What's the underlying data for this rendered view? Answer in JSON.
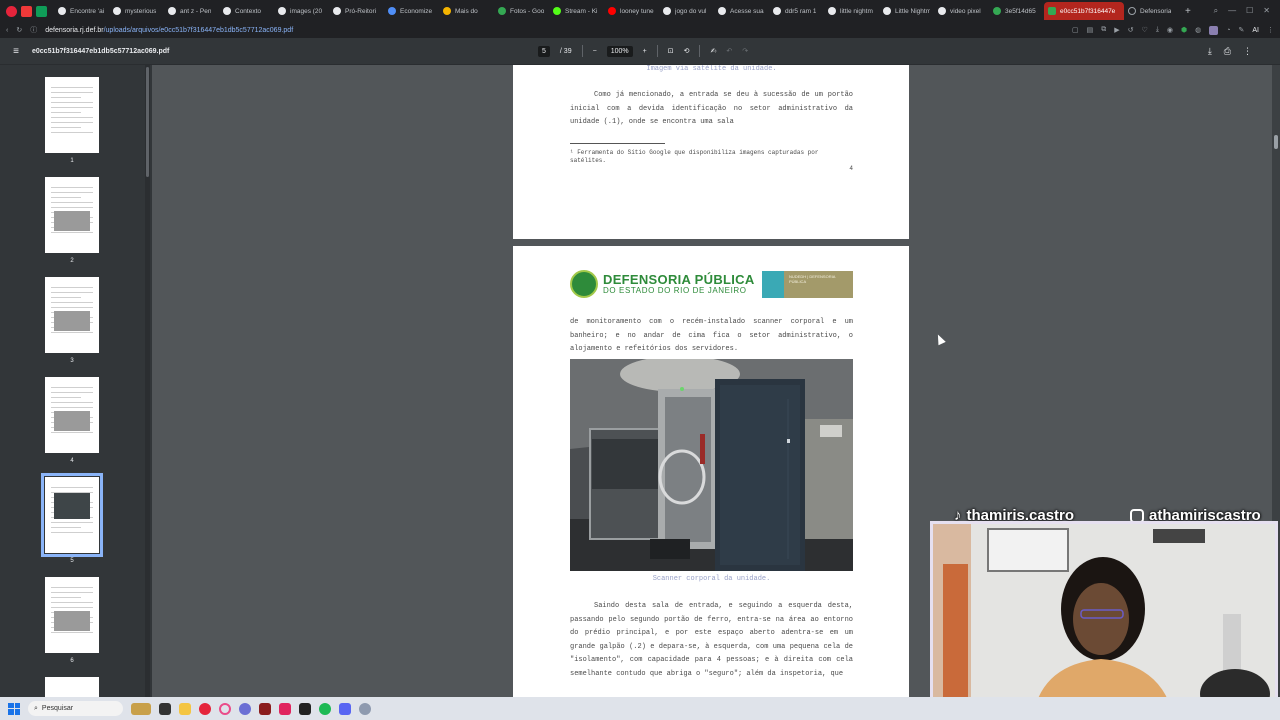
{
  "browser": {
    "tabs": [
      {
        "label": "Encontre 'ai",
        "color": "#e8eaed"
      },
      {
        "label": "mysterious",
        "color": "#e8eaed"
      },
      {
        "label": "ant z - Pen",
        "color": "#e8eaed"
      },
      {
        "label": "Contexto",
        "color": "#e8eaed"
      },
      {
        "label": "images (20",
        "color": "#e8eaed"
      },
      {
        "label": "Pró-Reitori",
        "color": "#e8eaed"
      },
      {
        "label": "Economize",
        "color": "#4f8ef7"
      },
      {
        "label": "Mais do",
        "color": "#f4b400"
      },
      {
        "label": "Fotos - Goo",
        "color": "#34a853"
      },
      {
        "label": "Stream - Ki",
        "color": "#53fc18"
      },
      {
        "label": "looney tune",
        "color": "#ff0000"
      },
      {
        "label": "jogo do vul",
        "color": "#e8eaed"
      },
      {
        "label": "Acesse sua",
        "color": "#e8eaed"
      },
      {
        "label": "ddr5 ram 1",
        "color": "#e8eaed"
      },
      {
        "label": "little nightm",
        "color": "#e8eaed"
      },
      {
        "label": "Little Nightm",
        "color": "#e8eaed"
      },
      {
        "label": "video pixel",
        "color": "#e8eaed"
      },
      {
        "label": "3e5f14d65",
        "color": "#34a853"
      }
    ],
    "active_tab": "e0cc51b7f316447e",
    "last_tab": "Defensoria",
    "url_host": "defensoria.rj.def.br",
    "url_path": "/uploads/arquivos/e0cc51b7f316447eb1db5c57712ac069.pdf",
    "ai_label": "AI"
  },
  "pdf_toolbar": {
    "doc_title": "e0cc51b7f316447eb1db5c57712ac069.pdf",
    "current_page": "5",
    "total_pages": "/ 39",
    "zoom": "100%"
  },
  "thumbnails": [
    "1",
    "2",
    "3",
    "4",
    "5",
    "6"
  ],
  "page_prev": {
    "caption": "Imagem via satélite da unidade.",
    "paragraph": "Como já mencionado, a entrada se deu à sucessão de um portão inicial com a devida identificação no setor administrativo da unidade (.1), onde se encontra uma sala",
    "footnote": "¹ Ferramenta do Sítio Google que disponibiliza imagens capturadas por satélites.",
    "page_number": "4"
  },
  "page_cur": {
    "logo_title": "DEFENSORIA PÚBLICA",
    "logo_subtitle": "DO ESTADO DO RIO DE JANEIRO",
    "nudedh": "NUDEDH | DEFENSORIA PÚBLICA",
    "para1": "de monitoramento com o recém-instalado scanner corporal e um banheiro; e no andar de cima fica o setor administrativo, o alojamento e refeitórios dos servidores.",
    "photo_caption": "Scanner corporal da unidade.",
    "para2": "Saindo desta sala de entrada, e seguindo a esquerda desta, passando pelo segundo portão de ferro, entra-se na área ao entorno do prédio principal, e por este espaço aberto adentra-se em um grande galpão (.2) e depara-se, à esquerda, com uma pequena cela de \"isolamento\", com capacidade para 4 pessoas; e à direita com cela semelhante contudo que abriga o \"seguro\"; além da inspetoria, que"
  },
  "overlay": {
    "tiktok": "thamiris.castro",
    "instagram": "athamiriscastro"
  },
  "taskbar": {
    "search_label": "Pesquisar"
  }
}
